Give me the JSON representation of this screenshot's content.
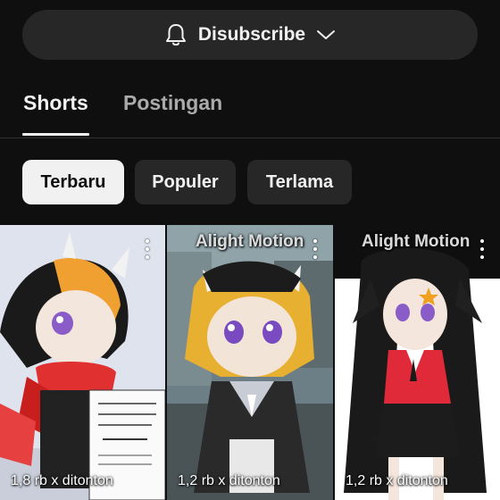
{
  "subscribe": {
    "label": "Disubscribe",
    "icon": "bell-icon",
    "chevron_icon": "chevron-down-icon"
  },
  "tabs": [
    {
      "label": "Shorts",
      "active": true
    },
    {
      "label": "Postingan",
      "active": false
    }
  ],
  "filters": [
    {
      "label": "Terbaru",
      "selected": true
    },
    {
      "label": "Populer",
      "selected": false
    },
    {
      "label": "Terlama",
      "selected": false
    }
  ],
  "shorts": [
    {
      "views": "1,8 rb x ditonton",
      "watermark": ""
    },
    {
      "views": "1,2 rb x ditonton",
      "watermark": "Alight Motion"
    },
    {
      "views": "1,2 rb x ditonton",
      "watermark": "Alight Motion"
    }
  ],
  "colors": {
    "background": "#0f0f0f",
    "button": "#272727",
    "text": "#f1f1f1",
    "muted": "#aaaaaa"
  }
}
